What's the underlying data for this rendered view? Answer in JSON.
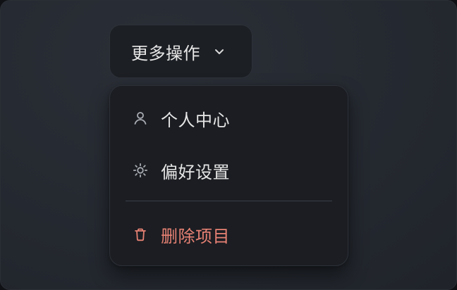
{
  "trigger": {
    "label": "更多操作",
    "icon": "chevron-down-icon"
  },
  "menu": {
    "items": [
      {
        "label": "个人中心",
        "icon": "user-icon"
      },
      {
        "label": "偏好设置",
        "icon": "sun-icon"
      },
      {
        "label": "删除项目",
        "icon": "trash-icon",
        "tone": "danger"
      }
    ]
  },
  "colors": {
    "background": "#23272e",
    "surface": "#1b1d22",
    "text": "#e6e6e6",
    "danger": "#e88274",
    "border": "#2d3138"
  }
}
